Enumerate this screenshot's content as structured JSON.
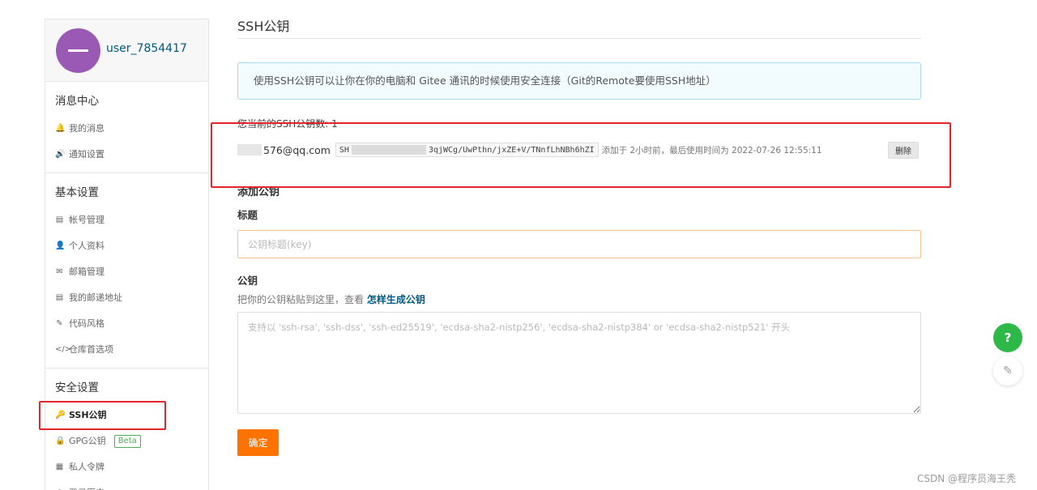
{
  "sidebar": {
    "username": "user_7854417",
    "avatar_color": "#9b59b6",
    "groups": [
      {
        "title": "消息中心",
        "items": [
          {
            "label": "我的消息",
            "icon": "bell-icon",
            "glyph": "🔔"
          },
          {
            "label": "通知设置",
            "icon": "speaker-icon",
            "glyph": "🔊"
          }
        ]
      },
      {
        "title": "基本设置",
        "items": [
          {
            "label": "帐号管理",
            "icon": "id-card-icon",
            "glyph": "▤"
          },
          {
            "label": "个人资料",
            "icon": "user-icon",
            "glyph": "👤"
          },
          {
            "label": "邮箱管理",
            "icon": "mail-icon",
            "glyph": "✉"
          },
          {
            "label": "我的邮递地址",
            "icon": "address-card-icon",
            "glyph": "▤"
          },
          {
            "label": "代码风格",
            "icon": "brush-icon",
            "glyph": "✎"
          },
          {
            "label": "仓库首选项",
            "icon": "code-icon",
            "glyph": "</>"
          }
        ]
      },
      {
        "title": "安全设置",
        "items": [
          {
            "label": "SSH公钥",
            "icon": "key-icon",
            "glyph": "🔑",
            "active": true
          },
          {
            "label": "GPG公钥",
            "icon": "lock-icon",
            "glyph": "🔒",
            "badge": "Beta"
          },
          {
            "label": "私人令牌",
            "icon": "token-icon",
            "glyph": "▦"
          },
          {
            "label": "登录历史",
            "icon": "history-icon",
            "glyph": "◷"
          }
        ]
      }
    ]
  },
  "main": {
    "title": "SSH公钥",
    "info": "使用SSH公钥可以让你在你的电脑和 Gitee 通讯的时候使用安全连接（Git的Remote要使用SSH地址）",
    "key_count_label": "您当前的SSH公钥数: 1",
    "key": {
      "email_suffix": "576@qq.com",
      "fingerprint_prefix": "SH",
      "fingerprint_suffix": "3qjWCg/UwPthn/jxZE+V/TNnfLhNBh6hZI",
      "meta": "添加于 2小时前，最后使用时间为 2022-07-26 12:55:11",
      "delete_label": "删除"
    },
    "add_title": "添加公钥",
    "title_label": "标题",
    "title_placeholder": "公钥标题(key)",
    "key_label": "公钥",
    "help_prefix": "把你的公钥粘贴到这里，查看",
    "help_link": "怎样生成公钥",
    "key_placeholder": "支持以 'ssh-rsa', 'ssh-dss', 'ssh-ed25519', 'ecdsa-sha2-nistp256', 'ecdsa-sha2-nistp384' or 'ecdsa-sha2-nistp521' 开头",
    "submit_label": "确定",
    "accent_color": "#fe7300"
  },
  "floating": {
    "help_glyph": "?",
    "feedback_glyph": "✎"
  },
  "watermark": "CSDN @程序员海王秃"
}
